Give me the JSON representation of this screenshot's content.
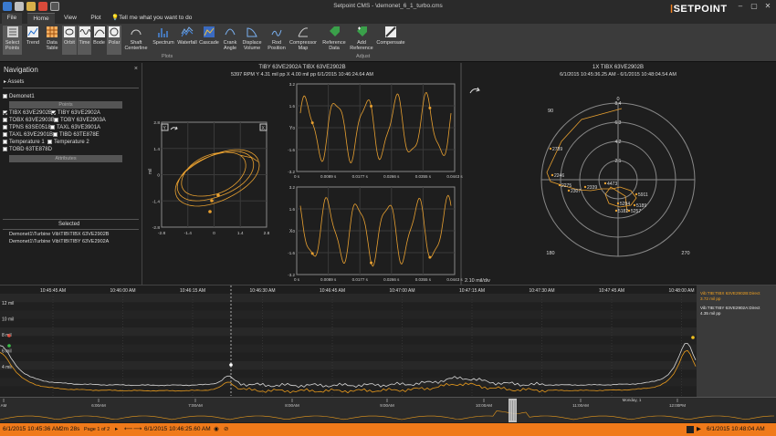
{
  "window": {
    "title": "Setpoint CMS - \\demonet_6_1_turbo.cms",
    "brand_prefix": "|",
    "brand_name": "SETPOINT",
    "min": "–",
    "max": "▢",
    "close": "✕"
  },
  "tabs": [
    "File",
    "Home",
    "View",
    "Plot"
  ],
  "tell_me": "Tell me what you want to do",
  "ribbon": {
    "buttons": [
      {
        "label": "Select Points"
      },
      {
        "label": "Trend"
      },
      {
        "label": "Data Table"
      },
      {
        "label": "Orbit"
      },
      {
        "label": "Time"
      },
      {
        "label": "Bode"
      },
      {
        "label": "Polar"
      },
      {
        "label": "Shaft Centerline"
      },
      {
        "label": "Spectrum"
      },
      {
        "label": "Waterfall"
      },
      {
        "label": "Cascade"
      },
      {
        "label": "Crank Angle"
      },
      {
        "label": "Displace Volume"
      },
      {
        "label": "Rod Position"
      },
      {
        "label": "Compressor Map"
      },
      {
        "label": "Reference Data"
      },
      {
        "label": "Add Reference"
      },
      {
        "label": "Compensate"
      }
    ],
    "groups": [
      "Plots",
      "Adjust"
    ]
  },
  "nav": {
    "title": "Navigation",
    "close": "×",
    "assets": "Assets",
    "root": "Demonet1",
    "points_header": "Points",
    "points": [
      {
        "label": "TIBX 63VE2902B",
        "checked": true
      },
      {
        "label": "TIBY 63VE2902A",
        "checked": true
      },
      {
        "label": "TOBX 63VE2903B",
        "checked": false
      },
      {
        "label": "TOBY 63VE2903A",
        "checked": false
      },
      {
        "label": "TPNS 63SE0518",
        "checked": false
      },
      {
        "label": "TAXL 63VE3901A",
        "checked": false
      },
      {
        "label": "TAXL 63VE2901B",
        "checked": false
      },
      {
        "label": "TIBD 63TE878E",
        "checked": false
      },
      {
        "label": "Temperature 1",
        "checked": false
      },
      {
        "label": "Temperature 2",
        "checked": false
      },
      {
        "label": "TOBD 63TE878D",
        "checked": false
      }
    ],
    "attributes_header": "Attributes",
    "selected_header": "Selected",
    "selected": [
      "Demonet1\\Turbine Vib\\TIB\\TIBX 63VE2902B",
      "Demonet1\\Turbine Vib\\TIB\\TIBY 63VE2902A"
    ]
  },
  "orbit": {
    "header1": "TIBY 63VE2902A  TIBX 63VE2902B",
    "header2": "5397 RPM   Y  4.31 mil pp   X  4.00 mil pp    6/1/2015 10:46:24.64 AM",
    "x_label": "X",
    "y_label": "Y",
    "unit": "mil",
    "ticks": [
      "2.8",
      "1.4",
      "0",
      "-1.4",
      "-2.8"
    ],
    "xticks": [
      "-2.8",
      "-1.4",
      "0",
      "1.4",
      "2.8"
    ],
    "time_y_ticks": [
      "3.2",
      "1.6",
      "0",
      "-1.6",
      "-3.2"
    ],
    "time_x_ticks": [
      "0 s",
      "0.0089 s",
      "0.0177 s",
      "0.0266 s",
      "0.0355 s",
      "0.0443 s"
    ],
    "time_top_label": "Y",
    "time_bottom_label": "X"
  },
  "polar": {
    "header1": "1X TIBX 63VE2902B",
    "header2": "6/1/2015 10:45:36.25 AM  -  6/1/2015 10:48:04.54 AM",
    "ring_labels": [
      "8.4",
      "6.3",
      "4.2",
      "2.1"
    ],
    "angles": [
      "0",
      "90",
      "180",
      "270"
    ],
    "scale": "2.10 mil/div",
    "point_labels": [
      "2789",
      "2246",
      "2275",
      "2307",
      "2339",
      "4473",
      "5911",
      "5294",
      "5182",
      "5189",
      "5257"
    ]
  },
  "trend": {
    "y_ticks": [
      "12 mil",
      "10 mil",
      "8 mil",
      "6 mil",
      "4 mil"
    ],
    "x_ticks": [
      "10:45:45 AM",
      "10:46:00 AM",
      "10:46:15 AM",
      "10:46:30 AM",
      "10:46:45 AM",
      "10:47:00 AM",
      "10:47:15 AM",
      "10:47:30 AM",
      "10:47:45 AM",
      "10:48:00 AM"
    ],
    "legend": [
      {
        "name": "Vib:TIB:TIBX 63VE2902B:Direct",
        "value": "3.72 mil pp",
        "color": "#f0a020"
      },
      {
        "name": "Vib:TIB:TIBY 63VE2902A:Direct",
        "value": "4.35 mil pp",
        "color": "#e8e8e8"
      }
    ],
    "colors": {
      "series_x": "#e89a1c",
      "series_y": "#d8d8d8"
    }
  },
  "overview": {
    "ticks": [
      "AM",
      "6:00AM",
      "7:00AM",
      "8:00AM",
      "9:00AM",
      "10:00AM",
      "11:00AM",
      "12:00PM"
    ],
    "day_label": "Monday, 1"
  },
  "status": {
    "start": "6/1/2015 10:45:36 AM",
    "duration": "2m 28s",
    "page": "Page 1 of 2",
    "cursor": "6/1/2015 10:46:25.60 AM",
    "end": "6/1/2015 10:48:04 AM"
  },
  "colors": {
    "accent": "#f07a1a",
    "orbit": "#e8a030",
    "background": "#1e1e1e"
  }
}
